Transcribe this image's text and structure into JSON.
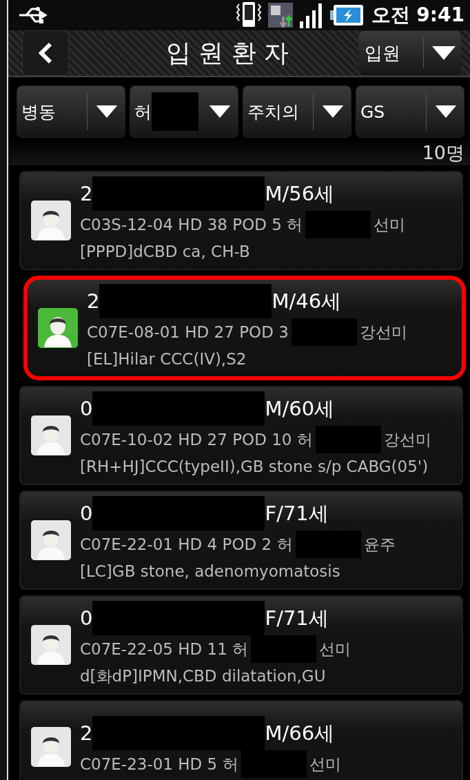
{
  "status_bar": {
    "time": "오전 9:41"
  },
  "header": {
    "title": "입 원 환 자",
    "mode_dropdown": {
      "value": "입원"
    }
  },
  "filters": [
    {
      "value": "병동",
      "redacted": false
    },
    {
      "value": "허",
      "redacted": true
    },
    {
      "value": "주치의",
      "redacted": false
    },
    {
      "value": "GS",
      "redacted": false
    }
  ],
  "count": "10명",
  "patients": [
    {
      "selected": false,
      "name_start": "2",
      "name_end": "M/56세",
      "detail_start": "C03S-12-04 HD 38 POD 5 허",
      "detail_end": "선미",
      "diagnosis": "[PPPD]dCBD ca, CH-B"
    },
    {
      "selected": true,
      "name_start": "2",
      "name_end": "M/46세",
      "detail_start": "C07E-08-01 HD 27 POD 3",
      "detail_end": "강선미",
      "diagnosis": "[EL]Hilar CCC(IV),S2"
    },
    {
      "selected": false,
      "name_start": "0",
      "name_end": "M/60세",
      "detail_start": "C07E-10-02 HD 27 POD 10 허",
      "detail_end": "강선미",
      "diagnosis": "[RH+HJ]CCC(typeII),GB stone s/p CABG(05')"
    },
    {
      "selected": false,
      "name_start": "0",
      "name_end": "F/71세",
      "detail_start": "C07E-22-01 HD 4 POD 2 허",
      "detail_end": "윤주",
      "diagnosis": "[LC]GB stone, adenomyomatosis"
    },
    {
      "selected": false,
      "name_start": "0",
      "name_end": "F/71세",
      "detail_start": "C07E-22-05 HD 11  허",
      "detail_end": "선미",
      "diagnosis": "d[화dP]IPMN,CBD dilatation,GU"
    },
    {
      "selected": false,
      "name_start": "2",
      "name_end": "M/66세",
      "detail_start": "C07E-23-01 HD 5  허",
      "detail_end": "선미"
    }
  ]
}
